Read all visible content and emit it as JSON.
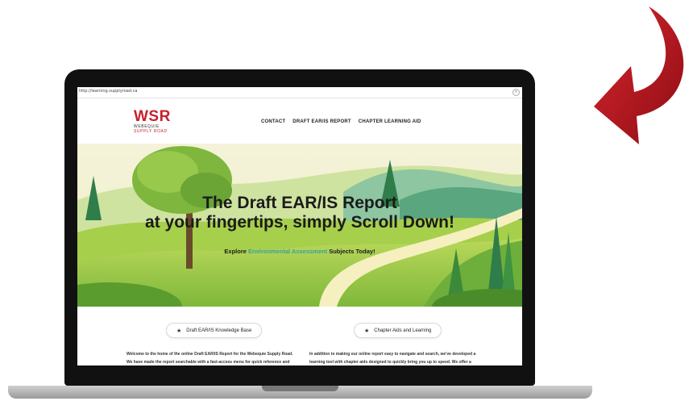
{
  "browser": {
    "url": "http://learning.supplyroad.ca"
  },
  "site": {
    "logo": {
      "abbr": "WSR",
      "line1": "WEBEQUIE",
      "line2": "SUPPLY ROAD"
    },
    "nav": [
      "CONTACT",
      "DRAFT EAR/IS REPORT",
      "CHAPTER LEARNING AID"
    ]
  },
  "hero": {
    "title_line1": "The Draft EAR/IS Report",
    "title_line2": "at your fingertips, simply Scroll Down!",
    "sub_before": "Explore ",
    "sub_highlight": "Environmental Assessment",
    "sub_after": " Subjects Today!"
  },
  "buttons": {
    "knowledge_base": "Draft EAR/IS Knowledge Base",
    "chapter_aids": "Chapter Aids and Learning"
  },
  "paragraphs": {
    "left": [
      "Welcome to the home of the online Draft EAR/IS Report for the Webequie Supply Road.",
      "We have made the report searchable with a fast-access menu for quick reference and"
    ],
    "right": [
      "In addition to making our online report easy to navigate and search, we've developed a",
      "learning tool with chapter aids designed to quickly bring you up to speed. We offer a"
    ]
  },
  "colors": {
    "brand_red": "#c8202a",
    "highlight_teal": "#3a9fa0",
    "arrow_red": "#b3141c"
  },
  "icons": {
    "star": "star-icon",
    "close": "close-icon",
    "arrow": "curved-arrow-icon"
  }
}
